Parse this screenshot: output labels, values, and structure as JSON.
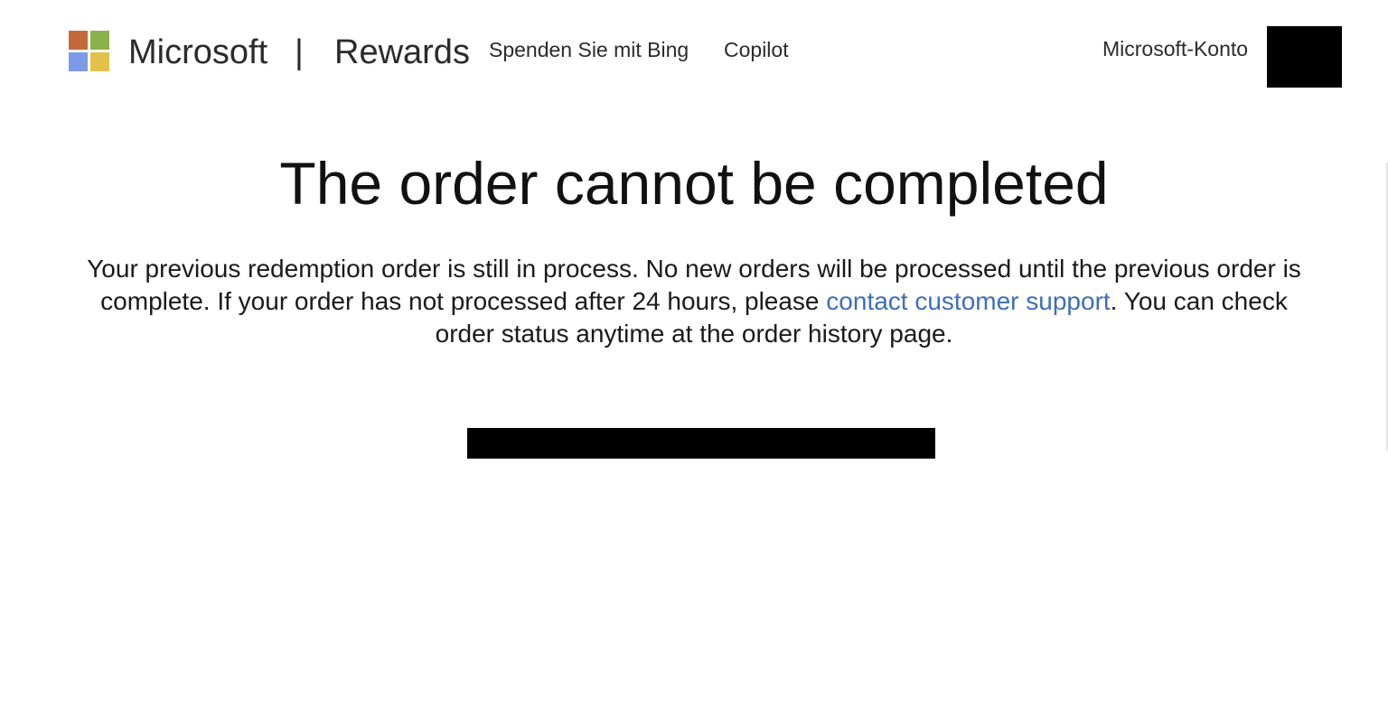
{
  "header": {
    "logo_colors": [
      "#c3693a",
      "#8ab24a",
      "#7d9ae8",
      "#e2c24a"
    ],
    "brand": "Microsoft",
    "separator": "|",
    "product": "Rewards",
    "nav": [
      {
        "label": "Spenden Sie mit Bing"
      },
      {
        "label": "Copilot"
      }
    ],
    "account_label": "Microsoft-Konto"
  },
  "main": {
    "title": "The order cannot be completed",
    "message_before_link": "Your previous redemption order is still in process. No new orders will be processed until the previous order is complete. If your order has not processed after 24 hours, please ",
    "support_link_label": "contact customer support",
    "message_after_link": ". You can check order status anytime at the order history page.",
    "link_color": "#3e6eb8"
  }
}
